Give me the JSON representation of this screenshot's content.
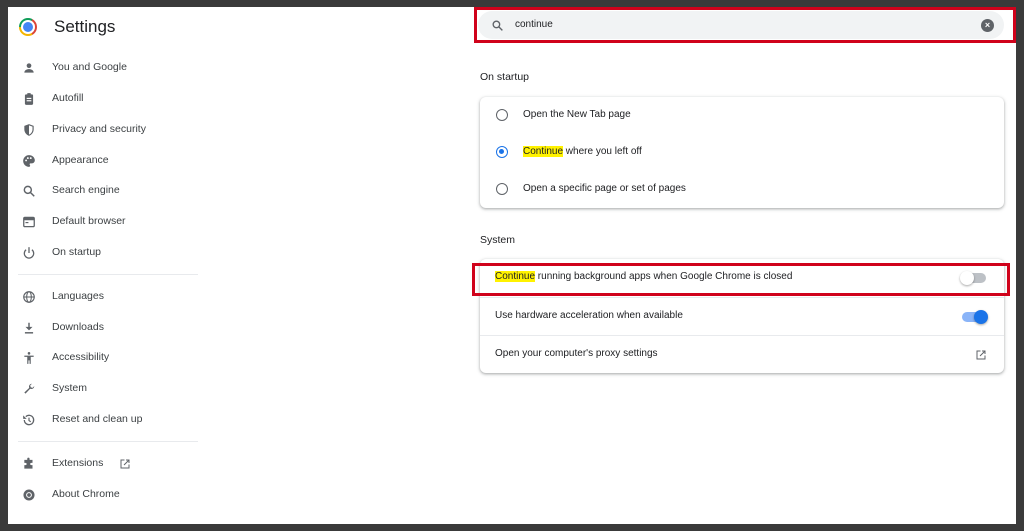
{
  "app": {
    "title": "Settings"
  },
  "search": {
    "value": "continue"
  },
  "sidebar": {
    "items": [
      {
        "label": "You and Google",
        "icon": "person-icon"
      },
      {
        "label": "Autofill",
        "icon": "clipboard-icon"
      },
      {
        "label": "Privacy and security",
        "icon": "shield-icon"
      },
      {
        "label": "Appearance",
        "icon": "palette-icon"
      },
      {
        "label": "Search engine",
        "icon": "search-icon"
      },
      {
        "label": "Default browser",
        "icon": "browser-icon"
      },
      {
        "label": "On startup",
        "icon": "power-icon"
      },
      {
        "label": "Languages",
        "icon": "globe-icon"
      },
      {
        "label": "Downloads",
        "icon": "download-icon"
      },
      {
        "label": "Accessibility",
        "icon": "accessibility-icon"
      },
      {
        "label": "System",
        "icon": "wrench-icon"
      },
      {
        "label": "Reset and clean up",
        "icon": "history-icon"
      },
      {
        "label": "Extensions",
        "icon": "puzzle-icon"
      },
      {
        "label": "About Chrome",
        "icon": "chrome-icon"
      }
    ]
  },
  "startup": {
    "title": "On startup",
    "options": [
      {
        "label": "Open the New Tab page",
        "checked": false
      },
      {
        "highlight": "Continue",
        "rest": " where you left off",
        "checked": true
      },
      {
        "label": "Open a specific page or set of pages",
        "checked": false
      }
    ]
  },
  "system": {
    "title": "System",
    "rows": [
      {
        "highlight": "Continue",
        "rest": " running background apps when Google Chrome is closed",
        "control": "toggle",
        "on": false
      },
      {
        "label": "Use hardware acceleration when available",
        "control": "toggle",
        "on": true
      },
      {
        "label": "Open your computer's proxy settings",
        "control": "external-link"
      }
    ]
  },
  "colors": {
    "accent": "#1a73e8",
    "highlight": "#fff200",
    "annotation": "#d0021b"
  }
}
